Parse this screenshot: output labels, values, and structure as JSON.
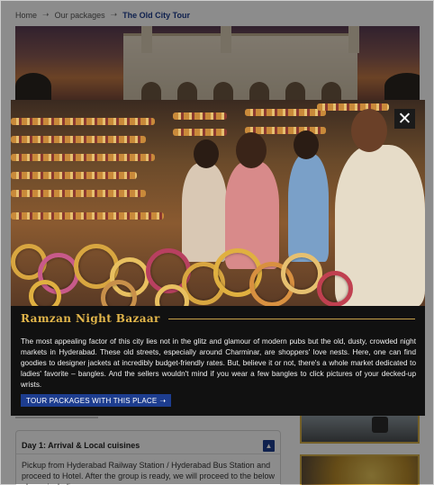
{
  "breadcrumb": {
    "items": [
      "Home",
      "Our packages"
    ],
    "current": "The Old City Tour",
    "separator_icon": "arrow-right-icon"
  },
  "itinerary": {
    "day_title": "Day 1: Arrival & Local cuisines",
    "toggle_icon": "chevron-up-icon",
    "day_text": "Pickup from Hyderabad Railway Station / Hyderabad Bus Station and proceed to Hotel. After the group is ready, we will proceed  to the below places including:"
  },
  "modal": {
    "title": "Ramzan Night Bazaar",
    "description": "The most appealing factor of this city lies not in the glitz and glamour of modern pubs but the old, dusty, crowded night markets in Hyderabad. These old streets, especially around Charminar, are shoppers' love nests. Here, one can find goodies to designer jackets at incredibly budget-friendly rates. But, believe it or not, there's a whole market dedicated to ladies' favorite – bangles. And the sellers wouldn't mind if you wear a few bangles to click pictures of your decked-up wrists.",
    "cta_label": "TOUR PACKAGES WITH THIS PLACE",
    "cta_icon": "arrow-right-icon",
    "close_icon": "close-icon"
  },
  "colors": {
    "accent_blue": "#1d3d8f",
    "title_gold": "#e2b64b",
    "modal_bg": "#111111",
    "overlay": "rgba(0,0,0,0.45)"
  }
}
